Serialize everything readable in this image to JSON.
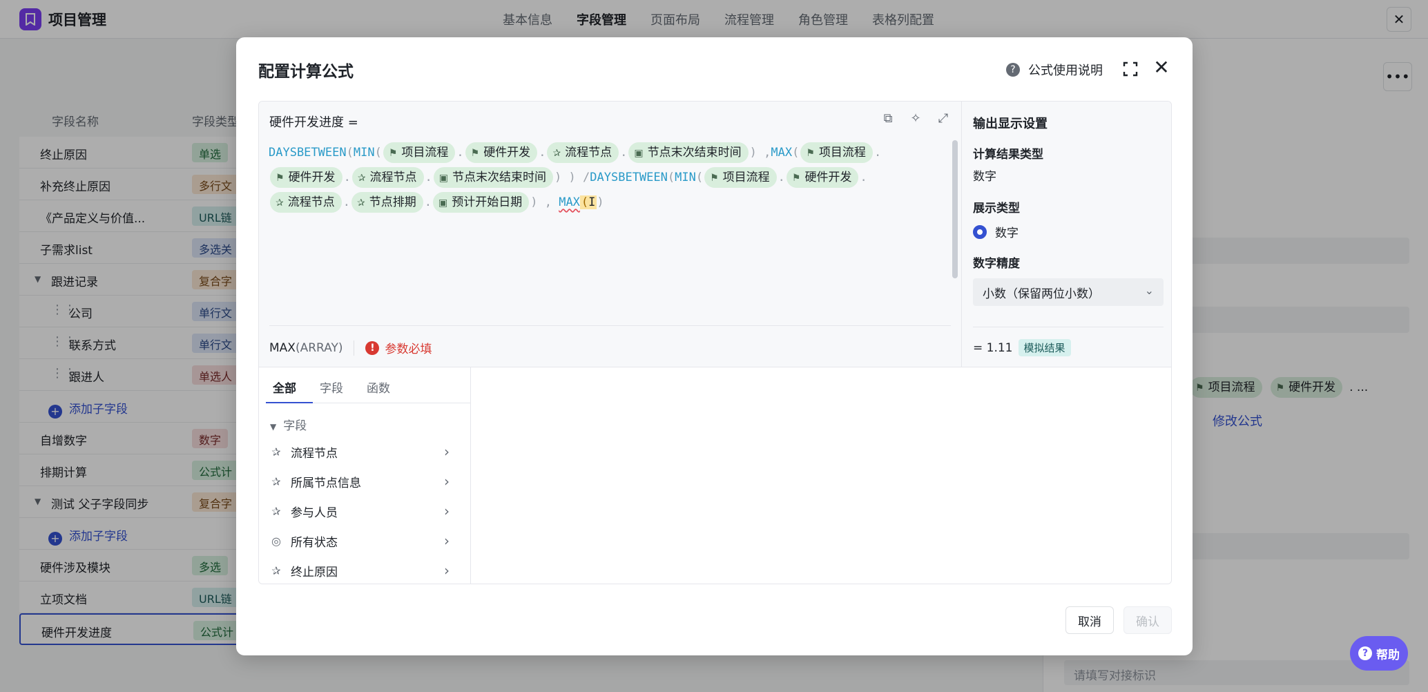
{
  "app": {
    "title": "项目管理",
    "logo_icon": "bookmark-icon"
  },
  "top_tabs": [
    {
      "label": "基本信息",
      "active": false
    },
    {
      "label": "字段管理",
      "active": true
    },
    {
      "label": "页面布局",
      "active": false
    },
    {
      "label": "流程管理",
      "active": false
    },
    {
      "label": "角色管理",
      "active": false
    },
    {
      "label": "表格列配置",
      "active": false
    }
  ],
  "field_table": {
    "headers": {
      "name": "字段名称",
      "type": "字段类型"
    },
    "rows": [
      {
        "name": "终止原因",
        "type": "单选"
      },
      {
        "name": "补充终止原因",
        "type": "多行文"
      },
      {
        "name": "《产品定义与价值...",
        "type": "URL链"
      },
      {
        "name": "子需求list",
        "type": "多选关"
      },
      {
        "name": "跟进记录",
        "type": "复合字"
      },
      {
        "name": "公司",
        "type": "单行文"
      },
      {
        "name": "联系方式",
        "type": "单行文"
      },
      {
        "name": "跟进人",
        "type": "单选人"
      },
      {
        "name": "添加子字段",
        "type": ""
      },
      {
        "name": "自增数字",
        "type": "数字"
      },
      {
        "name": "排期计算",
        "type": "公式计"
      },
      {
        "name": "测试 父子字段同步",
        "type": "复合字"
      },
      {
        "name": "添加子字段",
        "type": ""
      },
      {
        "name": "硬件涉及模块",
        "type": "多选"
      },
      {
        "name": "立项文档",
        "type": "URL链"
      },
      {
        "name": "硬件开发进度",
        "type": "公式计"
      }
    ]
  },
  "right_panel": {
    "chips": [
      "项目流程",
      "硬件开发"
    ],
    "chips_more": ". ...",
    "edit_link": "修改公式",
    "placeholder": "请填写对接标识"
  },
  "help_button": {
    "label": "帮助"
  },
  "modal": {
    "title": "配置计算公式",
    "help_link": "公式使用说明",
    "editor": {
      "field_label": "硬件开发进度 =",
      "signature": {
        "fn": "MAX",
        "args": "(ARRAY)"
      },
      "error": "参数必填",
      "formula": {
        "daysbetween": "DAYSBETWEEN",
        "min": "MIN",
        "max": "MAX",
        "open": "(",
        "close": ")",
        "dot": ".",
        "comma": ",",
        "div": "/",
        "chip_project": "项目流程",
        "chip_hardware": "硬件开发",
        "chip_node": "流程节点",
        "chip_end_time": "节点末次结束时间",
        "chip_schedule": "节点排期",
        "chip_start_date": "预计开始日期",
        "cursor": "I"
      }
    },
    "settings": {
      "title": "输出显示设置",
      "result_type_label": "计算结果类型",
      "result_type_value": "数字",
      "display_type_label": "展示类型",
      "display_type_option": "数字",
      "precision_label": "数字精度",
      "precision_value": "小数（保留两位小数）",
      "result": "= 1.11",
      "result_badge": "模拟结果"
    },
    "lower": {
      "tabs": [
        {
          "label": "全部",
          "active": true
        },
        {
          "label": "字段",
          "active": false
        },
        {
          "label": "函数",
          "active": false
        }
      ],
      "tree_header": "字段",
      "items": [
        {
          "label": "流程节点",
          "icon": "node-star-icon"
        },
        {
          "label": "所属节点信息",
          "icon": "node-star-icon"
        },
        {
          "label": "参与人员",
          "icon": "node-star-icon"
        },
        {
          "label": "所有状态",
          "icon": "status-circle-icon"
        },
        {
          "label": "终止原因",
          "icon": "node-star-icon"
        }
      ]
    },
    "buttons": {
      "cancel": "取消",
      "confirm": "确认"
    }
  }
}
